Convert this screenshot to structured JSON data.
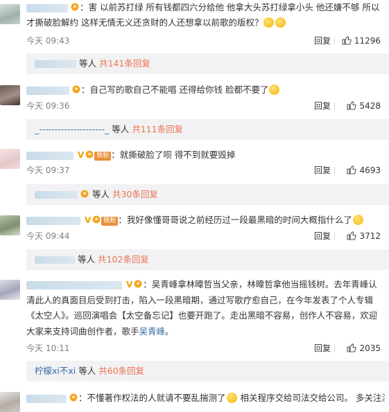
{
  "comments": [
    {
      "text": "害 以前苏打绿 所有钱都四六分给他 他拿大头苏打绿拿小头 他还嫌不够 所以才撕破脸解约 这样无情无义还贪财的人还想拿以前歌的版权？",
      "time": "今天 09:43",
      "reply_label": "回复",
      "likes": "11296",
      "more_label": "等人",
      "more_count": "共141条回复"
    },
    {
      "text": "自己写的歌自己不能唱 还得给你钱  脸都不要了",
      "time": "今天 09:36",
      "reply_label": "回复",
      "likes": "5428",
      "more_prefix": "_---------------------_",
      "more_label": "等人",
      "more_count": "共111条回复"
    },
    {
      "text": "就撕破脸了呗 得不到就要毁掉",
      "badge": "铁粉",
      "time": "今天 09:37",
      "reply_label": "回复",
      "likes": "4693",
      "more_label": "等人",
      "more_count": "共30条回复"
    },
    {
      "text": "我好像懂哥哥说之前经历过一段最黑暗的时间大概指什么了",
      "badge": "铁粉",
      "time": "今天 09:44",
      "reply_label": "回复",
      "likes": "3712",
      "more_label": "等人",
      "more_count": "共102条回复"
    },
    {
      "text_1": "吴青峰拿林暐哲当父亲，林暐哲拿他当摇钱树。去年青峰认清此人的真面目后受到打击，陷入一段黑暗期，通过写歌疗愈自己，在今年发表了个人专辑《太空人》。巡回演唱会【太空备忘记】也要开跑了。走出黑暗不容易，创作人不容易，欢迎大家来支持词曲创作者，歌手",
      "text_highlight": "吴青峰",
      "text_2": "。",
      "time": "今天 10:11",
      "reply_label": "回复",
      "likes": "2035",
      "more_prefix": "柠檬xi不xi",
      "more_label": "等人",
      "more_count": "共60条回复"
    },
    {
      "text": "不懂著作权法的人就请不要乱揣测了",
      "text_tail": " 相关程序交给司法交给公司。 多关注演"
    }
  ]
}
